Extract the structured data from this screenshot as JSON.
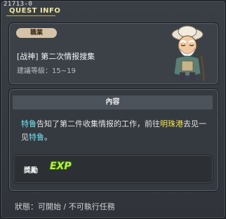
{
  "window": {
    "quest_id": "21713-0",
    "title": "QUEST INFO"
  },
  "summary": {
    "job_badge": "職業",
    "quest_name": "[战神] 第二次情报搜集",
    "level_requirement": "建議等級：15~19",
    "npc_portrait_icon": "old-man-npc-icon"
  },
  "content": {
    "header": "內容",
    "description_parts": {
      "npc_name_1": "特鲁",
      "text_1": "告知了第二件收集情报的工作，前往",
      "location": "明珠港",
      "text_2": "去见一见",
      "npc_name_2": "特鲁",
      "text_3": "。"
    },
    "highlight_colors": {
      "npc": "#6fe3f0",
      "location": "#f3e54a"
    }
  },
  "reward": {
    "label": "獎勵",
    "exp_icon_text": "EXP"
  },
  "status": {
    "text": "狀態：可開始 / 不可執行任務"
  }
}
